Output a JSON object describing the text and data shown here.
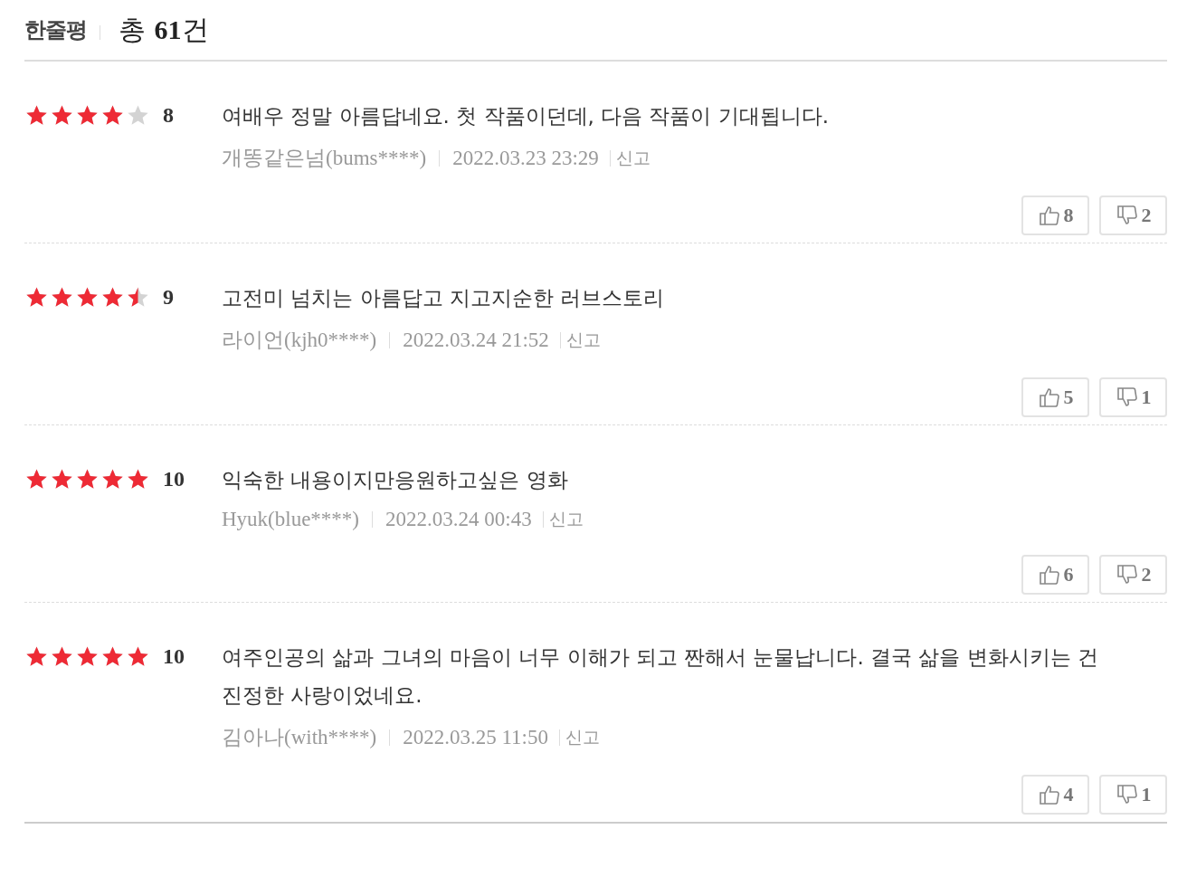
{
  "header": {
    "title": "한줄평",
    "count_prefix": "총",
    "count": "61",
    "count_suffix": "건"
  },
  "reviews": [
    {
      "stars": 4,
      "score": "8",
      "text": "여배우 정말 아름답네요. 첫 작품이던데, 다음 작품이 기대됩니다.",
      "author": "개똥같은넘(bums****)",
      "date": "2022.03.23 23:29",
      "report": "신고",
      "likes": "8",
      "dislikes": "2"
    },
    {
      "stars": 4.5,
      "score": "9",
      "text": "고전미 넘치는 아름답고 지고지순한 러브스토리",
      "author": "라이언(kjh0****)",
      "date": "2022.03.24 21:52",
      "report": "신고",
      "likes": "5",
      "dislikes": "1"
    },
    {
      "stars": 5,
      "score": "10",
      "text": "익숙한 내용이지만응원하고싶은 영화",
      "author": "Hyuk(blue****)",
      "date": "2022.03.24 00:43",
      "report": "신고",
      "likes": "6",
      "dislikes": "2"
    },
    {
      "stars": 5,
      "score": "10",
      "text": "여주인공의 삶과 그녀의 마음이 너무 이해가 되고 짠해서 눈물납니다. 결국 삶을 변화시키는 건 진정한 사랑이었네요.",
      "author": "김아나(with****)",
      "date": "2022.03.25 11:50",
      "report": "신고",
      "likes": "4",
      "dislikes": "1"
    }
  ]
}
